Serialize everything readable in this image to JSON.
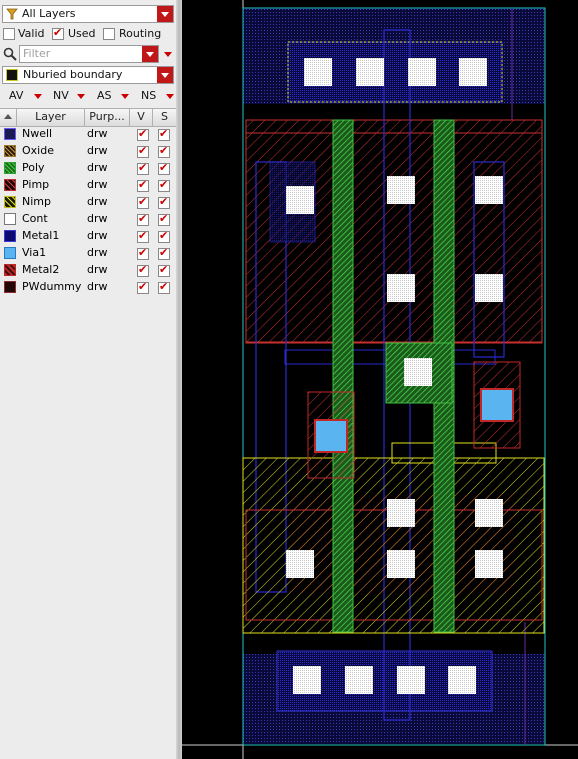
{
  "panel": {
    "filter_select": "All Layers",
    "valid_label": "Valid",
    "valid_checked": false,
    "used_label": "Used",
    "used_checked": true,
    "routing_label": "Routing",
    "routing_checked": false,
    "search_placeholder": "Filter",
    "current_layer": "Nburied boundary",
    "toggles": [
      "AV",
      "NV",
      "AS",
      "NS"
    ],
    "table_headers": {
      "layer": "Layer",
      "purpose": "Purp...",
      "v": "V",
      "s": "S"
    },
    "layers": [
      {
        "name": "Nwell",
        "purpose": "drw",
        "visible": true,
        "selectable": true,
        "color": "#2a2a9a"
      },
      {
        "name": "Oxide",
        "purpose": "drw",
        "visible": true,
        "selectable": true,
        "color": "#6a4a20"
      },
      {
        "name": "Poly",
        "purpose": "drw",
        "visible": true,
        "selectable": true,
        "color": "#2eb82e"
      },
      {
        "name": "Pimp",
        "purpose": "drw",
        "visible": true,
        "selectable": true,
        "color": "#c83a3a"
      },
      {
        "name": "Nimp",
        "purpose": "drw",
        "visible": true,
        "selectable": true,
        "color": "#d8d818"
      },
      {
        "name": "Cont",
        "purpose": "drw",
        "visible": true,
        "selectable": true,
        "color": "#ffffff"
      },
      {
        "name": "Metal1",
        "purpose": "drw",
        "visible": true,
        "selectable": true,
        "color": "#1a1aa0"
      },
      {
        "name": "Via1",
        "purpose": "drw",
        "visible": true,
        "selectable": true,
        "color": "#5ab4f0"
      },
      {
        "name": "Metal2",
        "purpose": "drw",
        "visible": true,
        "selectable": true,
        "color": "#c02828"
      },
      {
        "name": "PWdummy",
        "purpose": "drw",
        "visible": true,
        "selectable": true,
        "color": "#8a1a1a"
      }
    ]
  },
  "colors": {
    "background": "#000000",
    "nwell": "#1a1a6a",
    "metal1": "#2020c0",
    "poly": "#30b830",
    "pimp": "#d04040",
    "nimp": "#e0e020",
    "contact": "#ffffff",
    "via1": "#5ab4f0",
    "metal2": "#c02828",
    "boundary": "#20c8c8",
    "panel_accent": "#c01818"
  }
}
